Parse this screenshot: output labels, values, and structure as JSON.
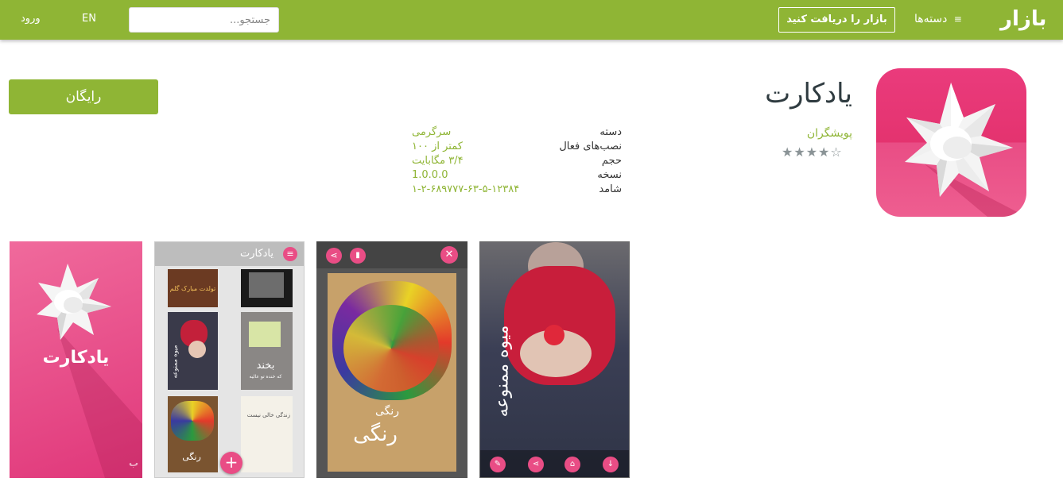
{
  "header": {
    "logo_text": "بازار",
    "categories_label": "دسته‌ها",
    "get_bazaar_label": "بازار را دریافت کنید",
    "search_placeholder": "جستجو...",
    "lang_label": "EN",
    "login_label": "ورود"
  },
  "app": {
    "title": "یادکارت",
    "developer": "پویشگران",
    "rating_stars": "★★★★☆",
    "install_label": "رایگان",
    "icon_name": "paper-flower-icon"
  },
  "info": [
    {
      "label": "دسته",
      "value": "سرگرمی"
    },
    {
      "label": "نصب‌های فعال",
      "value": "کمتر از ۱۰۰"
    },
    {
      "label": "حجم",
      "value": "۳/۴ مگابایت"
    },
    {
      "label": "نسخه",
      "value": "1.0.0.0"
    },
    {
      "label": "شامد",
      "value": "۱-۲-۶۸۹۷۷۷-۶۳-۵-۱۲۳۸۴"
    }
  ],
  "screenshots": {
    "s1": {
      "title": "یادکارت"
    },
    "s2": {
      "header": "یادکارت",
      "card1": "تولدت مبارک گلم",
      "card2": "بخند",
      "card2_sub": "که خنده تو عالیه",
      "card3": "میوه ممنوعه",
      "card4": "رنگی",
      "card5": "زندگی خالی نیست"
    },
    "s3": {
      "text_small": "رنگی",
      "text_big": "رنگی"
    },
    "s4": {
      "vertical_text": "میوه ممنوعه"
    }
  },
  "colors": {
    "brand": "#8fb535",
    "icon_pink": "#e4336f"
  }
}
